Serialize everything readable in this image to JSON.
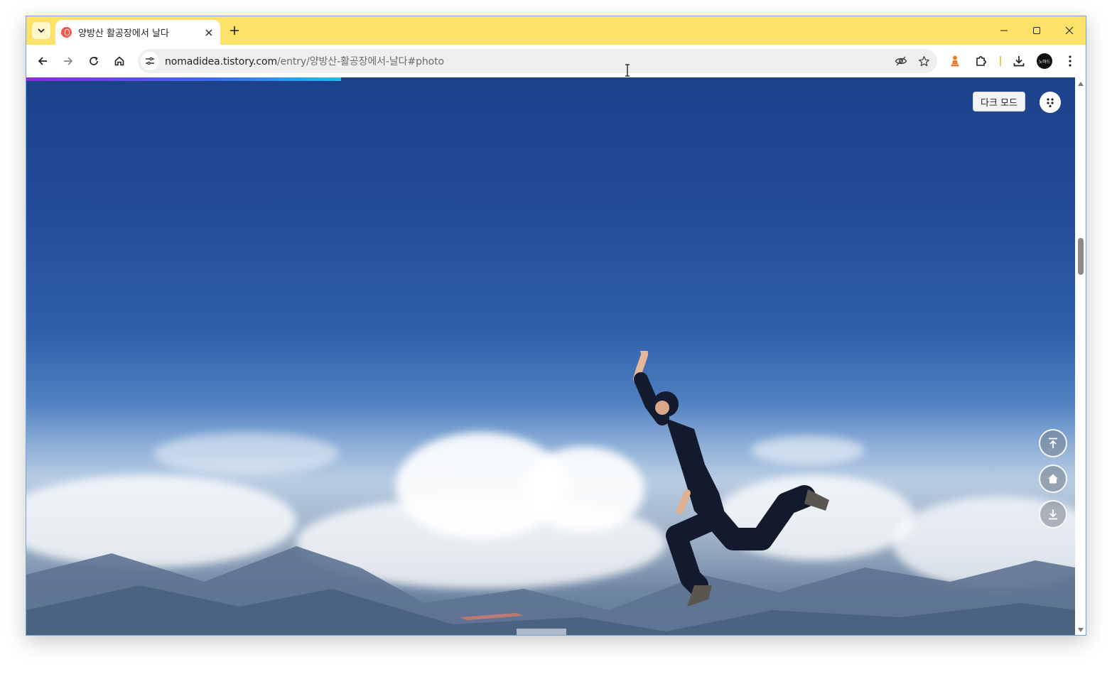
{
  "browser": {
    "tab": {
      "title": "양방산 활공장에서 날다"
    },
    "address": {
      "host": "nomadidea.tistory.com",
      "path": "/entry/양방산-활공장에서-날다#photo"
    },
    "profile_avatar_text": "노마드"
  },
  "page": {
    "dark_mode_label": "다크 모드",
    "reading_progress_percent": 30,
    "photo_description_icons": [
      "scroll-top-icon",
      "home-icon",
      "scroll-bottom-icon"
    ]
  },
  "colors": {
    "tabstrip": "#fde26a",
    "progress_start": "#8b2bd9",
    "progress_end": "#27b8f0",
    "sky_top": "#1d428c"
  }
}
